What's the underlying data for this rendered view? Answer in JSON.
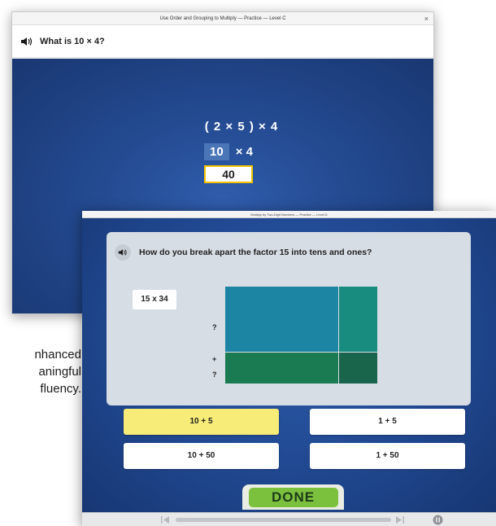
{
  "back_window": {
    "title": "Use Order and Grouping to Multiply — Practice — Level C",
    "close_symbol": "×",
    "question": "What is 10 × 4?",
    "expression_line1": "( 2 × 5 ) × 4",
    "expression_line2_highlight": "10",
    "expression_line2_rest": "× 4",
    "answer": "40"
  },
  "background_text": {
    "line1": "nhanced",
    "line2": "aningful",
    "line3": "fluency."
  },
  "front_window": {
    "title": "Multiply by Two-Digit Numbers — Practice — Level D",
    "question": "How do you break apart the factor 15 into tens and ones?",
    "factor_label": "15 x 34",
    "row_label_top": "?",
    "row_label_plus": "+",
    "row_label_bottom": "?",
    "area_colors": {
      "tens_left": "#1b85a3",
      "tens_right": "#178c7f",
      "ones_left": "#1a7a52",
      "ones_right": "#18654c"
    },
    "options": [
      {
        "label": "10 + 5",
        "selected": true
      },
      {
        "label": "1 + 5",
        "selected": false
      },
      {
        "label": "10 + 50",
        "selected": false
      },
      {
        "label": "1 + 50",
        "selected": false
      }
    ],
    "done_label": "DONE",
    "accent_color": "#7cc13e",
    "selected_color": "#f7ec77"
  }
}
